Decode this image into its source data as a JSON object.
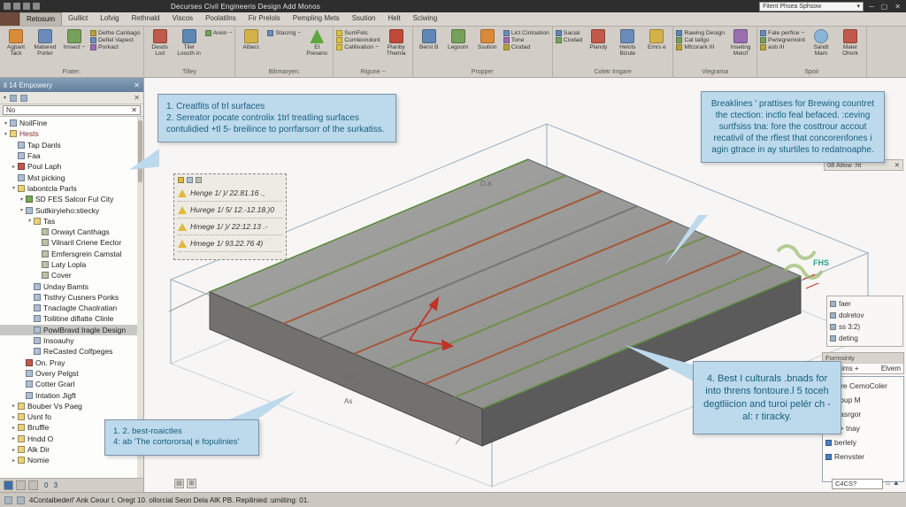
{
  "theme": {
    "callout_bg": "#bdd9ec",
    "callout_border": "#7d93a8",
    "callout_text": "#16607e",
    "selection": "#3b6ea5",
    "warning": "#e3b73c"
  },
  "titlebar": {
    "title": "Decurses Civil Engineeris Design Add Monos",
    "search": "Fitent Phsea Sphsow",
    "window_buttons": [
      "─",
      "▢",
      "✕"
    ]
  },
  "menubar": {
    "active_index": 0,
    "tabs": [
      "Retosum",
      "Gullict",
      "Lofvig",
      "Rethnald",
      "Viscos",
      "Poolatilns",
      "Fir Prelols",
      "Pempling Mets",
      "Ssution",
      "Helt",
      "Sciwing"
    ]
  },
  "ribbon": {
    "groups": [
      {
        "caption": "Frater:",
        "tools": [
          {
            "label": "Agjtant Tack",
            "kind": "big",
            "icon": "panel-icon",
            "color": "#d98b3a"
          },
          {
            "label": "Matwred Porter",
            "kind": "big",
            "icon": "table-icon",
            "color": "#6b8cba"
          },
          {
            "label": "Imsect −",
            "kind": "big",
            "icon": "insert-icon",
            "color": "#76a05c"
          },
          {
            "label": "Dethe Canbago",
            "kind": "small",
            "icon": "check-icon",
            "color": "#b8a23e"
          },
          {
            "label": "Defiel Vapect",
            "kind": "small",
            "icon": "check-icon",
            "color": "#6b8cba"
          },
          {
            "label": "Porkact",
            "kind": "small",
            "icon": "check-icon",
            "color": "#9a6fb0"
          }
        ]
      },
      {
        "caption": "Tilley",
        "tools": [
          {
            "label": "Desds Lod",
            "kind": "big",
            "icon": "grid-icon",
            "color": "#c05a4a"
          },
          {
            "label": "Tilel Loocth in",
            "kind": "big",
            "icon": "tile-icon",
            "color": "#5f87b5"
          },
          {
            "label": "Arein −",
            "kind": "small",
            "icon": "area-icon",
            "color": "#76a05c"
          }
        ]
      },
      {
        "caption": "Bilrmaryen:",
        "tools": [
          {
            "label": "Albecr.",
            "kind": "big",
            "icon": "layers-icon",
            "color": "#d4b24a"
          },
          {
            "label": "Stacmg −",
            "kind": "small",
            "icon": "stack-icon",
            "color": "#6b8cba"
          },
          {
            "label": "Et Presens",
            "kind": "big",
            "icon": "triangle-icon",
            "color": "#5da641"
          }
        ]
      },
      {
        "caption": "Rigune −",
        "tools": [
          {
            "label": "SumFelc",
            "kind": "small",
            "icon": "warning-icon",
            "color": "#d8c13e"
          },
          {
            "label": "Cumleondont",
            "kind": "small",
            "icon": "warning-icon",
            "color": "#d8c13e"
          },
          {
            "label": "Calilivation −",
            "kind": "small",
            "icon": "warning-icon",
            "color": "#d8c13e"
          },
          {
            "label": "Planby Themla",
            "kind": "big",
            "icon": "profile-icon",
            "color": "#bf4a3a"
          }
        ]
      },
      {
        "caption": "Propper",
        "tools": [
          {
            "label": "Berst B",
            "kind": "big",
            "icon": "band-icon",
            "color": "#5f87b5"
          },
          {
            "label": "Legoom",
            "kind": "big",
            "icon": "legend-icon",
            "color": "#76a05c"
          },
          {
            "label": "Ssution",
            "kind": "big",
            "icon": "section-icon",
            "color": "#d98b3a"
          },
          {
            "label": "Lict Cintoation",
            "kind": "small",
            "icon": "list-icon",
            "color": "#6b8cba"
          },
          {
            "label": "Tone",
            "kind": "small",
            "icon": "tone-icon",
            "color": "#9a6fb0"
          },
          {
            "label": "Ciodad",
            "kind": "small",
            "icon": "node-icon",
            "color": "#b8a23e"
          }
        ]
      },
      {
        "caption": "Coletr Imgare",
        "tools": [
          {
            "label": "Sacial",
            "kind": "small",
            "icon": "social-icon",
            "color": "#5f87b5"
          },
          {
            "label": "Ciodad",
            "kind": "small",
            "icon": "node-icon",
            "color": "#76a05c"
          },
          {
            "label": "Plandy",
            "kind": "big",
            "icon": "plan-icon",
            "color": "#c05a4a"
          },
          {
            "label": "Helots Bizule",
            "kind": "big",
            "icon": "helper-icon",
            "color": "#6b8cba"
          },
          {
            "label": "Emrs e",
            "kind": "big",
            "icon": "export-icon",
            "color": "#d4b24a"
          }
        ]
      },
      {
        "caption": "Viegrama",
        "tools": [
          {
            "label": "Rawing Design",
            "kind": "small",
            "icon": "check-icon",
            "color": "#5f87b5"
          },
          {
            "label": "Cal tailgo",
            "kind": "small",
            "icon": "check-icon",
            "color": "#76a05c"
          },
          {
            "label": "Mfcorark III",
            "kind": "small",
            "icon": "check-icon",
            "color": "#b8a23e"
          },
          {
            "label": "Inseting Metof",
            "kind": "big",
            "icon": "insert-icon",
            "color": "#9a6fb0"
          }
        ]
      },
      {
        "caption": "Spoir",
        "tools": [
          {
            "label": "Fale perfice −",
            "kind": "small",
            "icon": "file-icon",
            "color": "#6b8cba"
          },
          {
            "label": "Pwregremoint",
            "kind": "small",
            "icon": "gear-icon",
            "color": "#76a05c"
          },
          {
            "label": "asb III",
            "kind": "small",
            "icon": "bars-icon",
            "color": "#b8a23e"
          },
          {
            "label": "Sandt Mam",
            "kind": "big",
            "icon": "cloud-icon",
            "color": "#8ab4d8"
          },
          {
            "label": "Maler Ohork",
            "kind": "big",
            "icon": "marker-icon",
            "color": "#c05a4a"
          }
        ]
      }
    ]
  },
  "left_panel": {
    "header": "it 14 Empowery",
    "filter_value": "No",
    "bottom_text": "0 3",
    "tree": [
      {
        "label": "NoilFine",
        "indent": 0,
        "icon": "doc",
        "exp": "▾"
      },
      {
        "label": "Hests",
        "indent": 0,
        "icon": "folder",
        "exp": "▾",
        "color": "#8a2b2b"
      },
      {
        "label": "Tap Danls",
        "indent": 1,
        "icon": "doc",
        "exp": ""
      },
      {
        "label": "Faa",
        "indent": 1,
        "icon": "doc",
        "exp": ""
      },
      {
        "label": "Poul Laph",
        "indent": 1,
        "icon": "point",
        "exp": "▸"
      },
      {
        "label": "Mst picking",
        "indent": 1,
        "icon": "doc",
        "exp": ""
      },
      {
        "label": "labontcla Parls",
        "indent": 1,
        "icon": "folder",
        "exp": "▾"
      },
      {
        "label": "SD FES Salcor Ful City",
        "indent": 2,
        "icon": "surface",
        "exp": "▾"
      },
      {
        "label": "Sutlkiryieho:stiecky",
        "indent": 2,
        "icon": "doc",
        "exp": "▾"
      },
      {
        "label": "Tas",
        "indent": 3,
        "icon": "folder",
        "exp": "▾"
      },
      {
        "label": "Orwayt Canthags",
        "indent": 4,
        "icon": "generic",
        "exp": ""
      },
      {
        "label": "Vilnaril Criene Eeclor",
        "indent": 4,
        "icon": "generic",
        "exp": ""
      },
      {
        "label": "Emfersgrein Camstal",
        "indent": 4,
        "icon": "generic",
        "exp": ""
      },
      {
        "label": "Laty Lopla",
        "indent": 4,
        "icon": "generic",
        "exp": ""
      },
      {
        "label": "Cover",
        "indent": 4,
        "icon": "generic",
        "exp": ""
      },
      {
        "label": "Unday Bamts",
        "indent": 3,
        "icon": "doc",
        "exp": ""
      },
      {
        "label": "Tisthry Cusners Ponks",
        "indent": 3,
        "icon": "doc",
        "exp": ""
      },
      {
        "label": "Tnaclagte Chaolratian",
        "indent": 3,
        "icon": "doc",
        "exp": ""
      },
      {
        "label": "Toilitine diflatte Clinle",
        "indent": 3,
        "icon": "doc",
        "exp": ""
      },
      {
        "label": "PowlBravd Iragle Design",
        "indent": 3,
        "icon": "doc",
        "exp": "",
        "selected": true
      },
      {
        "label": "Insoauhy",
        "indent": 3,
        "icon": "doc",
        "exp": ""
      },
      {
        "label": "ReCasted Colfpeges",
        "indent": 3,
        "icon": "doc",
        "exp": ""
      },
      {
        "label": "On. Pray",
        "indent": 2,
        "icon": "point",
        "exp": ""
      },
      {
        "label": "Overy Pelgst",
        "indent": 2,
        "icon": "doc",
        "exp": ""
      },
      {
        "label": "Cotter Grarl",
        "indent": 2,
        "icon": "doc",
        "exp": ""
      },
      {
        "label": "Intation Jigft",
        "indent": 2,
        "icon": "doc",
        "exp": ""
      },
      {
        "label": "Bouber Vs Paeg",
        "indent": 1,
        "icon": "folder",
        "exp": "▸"
      },
      {
        "label": "Usnt fo",
        "indent": 1,
        "icon": "folder",
        "exp": "▸"
      },
      {
        "label": "Bruffle",
        "indent": 1,
        "icon": "folder",
        "exp": "▸"
      },
      {
        "label": "Hndd O",
        "indent": 1,
        "icon": "folder",
        "exp": "▸"
      },
      {
        "label": "Alk Dir",
        "indent": 1,
        "icon": "folder",
        "exp": "▸"
      },
      {
        "label": "Nomie",
        "indent": 1,
        "icon": "folder",
        "exp": "▸"
      }
    ]
  },
  "viewport": {
    "labels": {
      "d1a": "D.a",
      "p4": "4,P",
      "as": "As",
      "fhs": "FHS"
    }
  },
  "callouts": {
    "top_left": "1.  Creatfits of trl surfaces\n2.  Sereator pocate controlix 1trl treatling surfaces contulidied +tl 5- breilince to porrfarsorr of the surkatiss.",
    "top_right": "Breaklines ' prattises for Brewing countret the ctection: inctlo feal befaced. :ceving surtfsiss tna: fore the costtrour accout recativil of the rflest that concorenfones i agin gtrace in ay sturtiles to redatnoaphe.",
    "bottom_right": "4.  Best I culturals .bnads for into threns fontoure.l 5 toceh degtliicion and turoi pelér ch -al: r tiracky.",
    "bottom_left": "1.  2. best-roaictles\n4:  ab 'The cortororsa| e fopulinies'"
  },
  "warning_list": {
    "rows": [
      "Henge 1/ )/ 22.81.16 .,",
      "Hurege 1/ 5/ 12.-12.18.)0",
      "Hmege 1/ )/ 22:12.13 .-",
      "Hmege 1/ 93.22.76 4)"
    ]
  },
  "right_panel": {
    "mini_header": "08 Atkiw :ht",
    "box1": [
      "faer",
      "dolretov",
      "ss 3:2)",
      "deting"
    ],
    "formsinty": {
      "header": "Formsinty",
      "left": "Pst Lims +",
      "right": "Elvem"
    },
    "box2": [
      "Fire CemoColer",
      "Coup  M",
      "Casrgor",
      "S> tnay",
      "berlely",
      "Renvster"
    ]
  },
  "statusbar": {
    "text": "4Contaibederl' Ank Ceour t. Oregt 10. ollorcial Seon Dela AlK PB. Repilinied :umiiting: 01.",
    "coords_box": "C4CS?"
  }
}
